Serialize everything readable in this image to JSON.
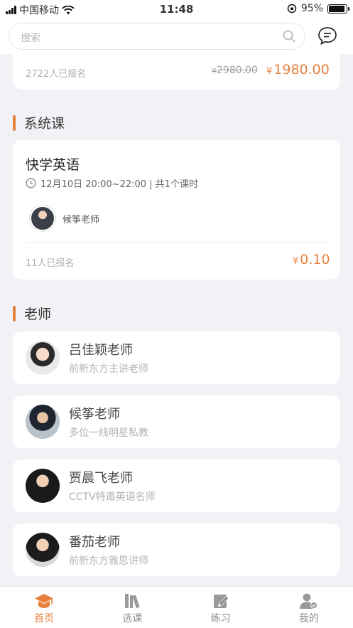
{
  "status": {
    "carrier": "中国移动",
    "time": "11:48",
    "battery": "95%"
  },
  "search": {
    "placeholder": "搜索"
  },
  "top_course": {
    "enrolled": "2722人已报名",
    "old_price": "2980.00",
    "price": "1980.00",
    "currency": "¥"
  },
  "sections": {
    "system": "系统课",
    "teachers": "老师"
  },
  "course": {
    "title": "快学英语",
    "time": "12月10日 20:00~22:00 | 共1个课时",
    "teacher": "候筝老师",
    "enrolled": "11人已报名",
    "price": "0.10",
    "currency": "¥"
  },
  "teachers": [
    {
      "name": "吕佳颖老师",
      "desc": "前新东方主讲老师"
    },
    {
      "name": "候筝老师",
      "desc": "多位一线明星私教"
    },
    {
      "name": "贾晨飞老师",
      "desc": "CCTV特邀英语名师"
    },
    {
      "name": "番茄老师",
      "desc": "前新东方雅思讲师"
    }
  ],
  "tabs": [
    {
      "label": "首页",
      "icon": "graduation-cap-icon",
      "active": true
    },
    {
      "label": "选课",
      "icon": "books-icon",
      "active": false
    },
    {
      "label": "练习",
      "icon": "edit-icon",
      "active": false
    },
    {
      "label": "我的",
      "icon": "user-icon",
      "active": false
    }
  ],
  "colors": {
    "accent": "#e7813f",
    "background": "#f1f2f5"
  }
}
